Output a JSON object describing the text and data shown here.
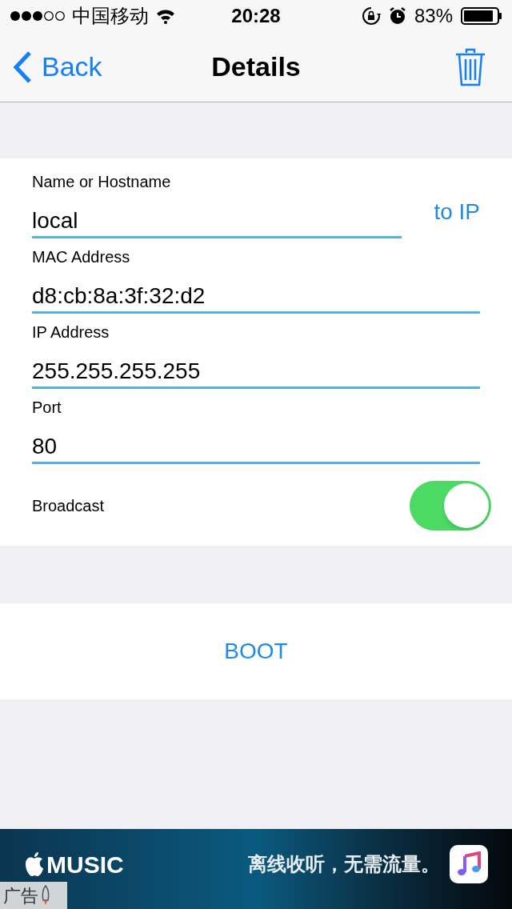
{
  "status_bar": {
    "carrier": "中国移动",
    "time": "20:28",
    "battery": "83%"
  },
  "nav": {
    "back": "Back",
    "title": "Details"
  },
  "fields": [
    {
      "label": "Name or Hostname",
      "value": "local",
      "action": "to IP"
    },
    {
      "label": "MAC Address",
      "value": "d8:cb:8a:3f:32:d2"
    },
    {
      "label": "IP Address",
      "value": "255.255.255.255"
    },
    {
      "label": "Port",
      "value": "80"
    }
  ],
  "broadcast": {
    "label": "Broadcast",
    "on": true
  },
  "boot_button": "BOOT",
  "ad": {
    "brand": "MUSIC",
    "tagline": "离线收听，无需流量。",
    "ad_label": "广告"
  }
}
